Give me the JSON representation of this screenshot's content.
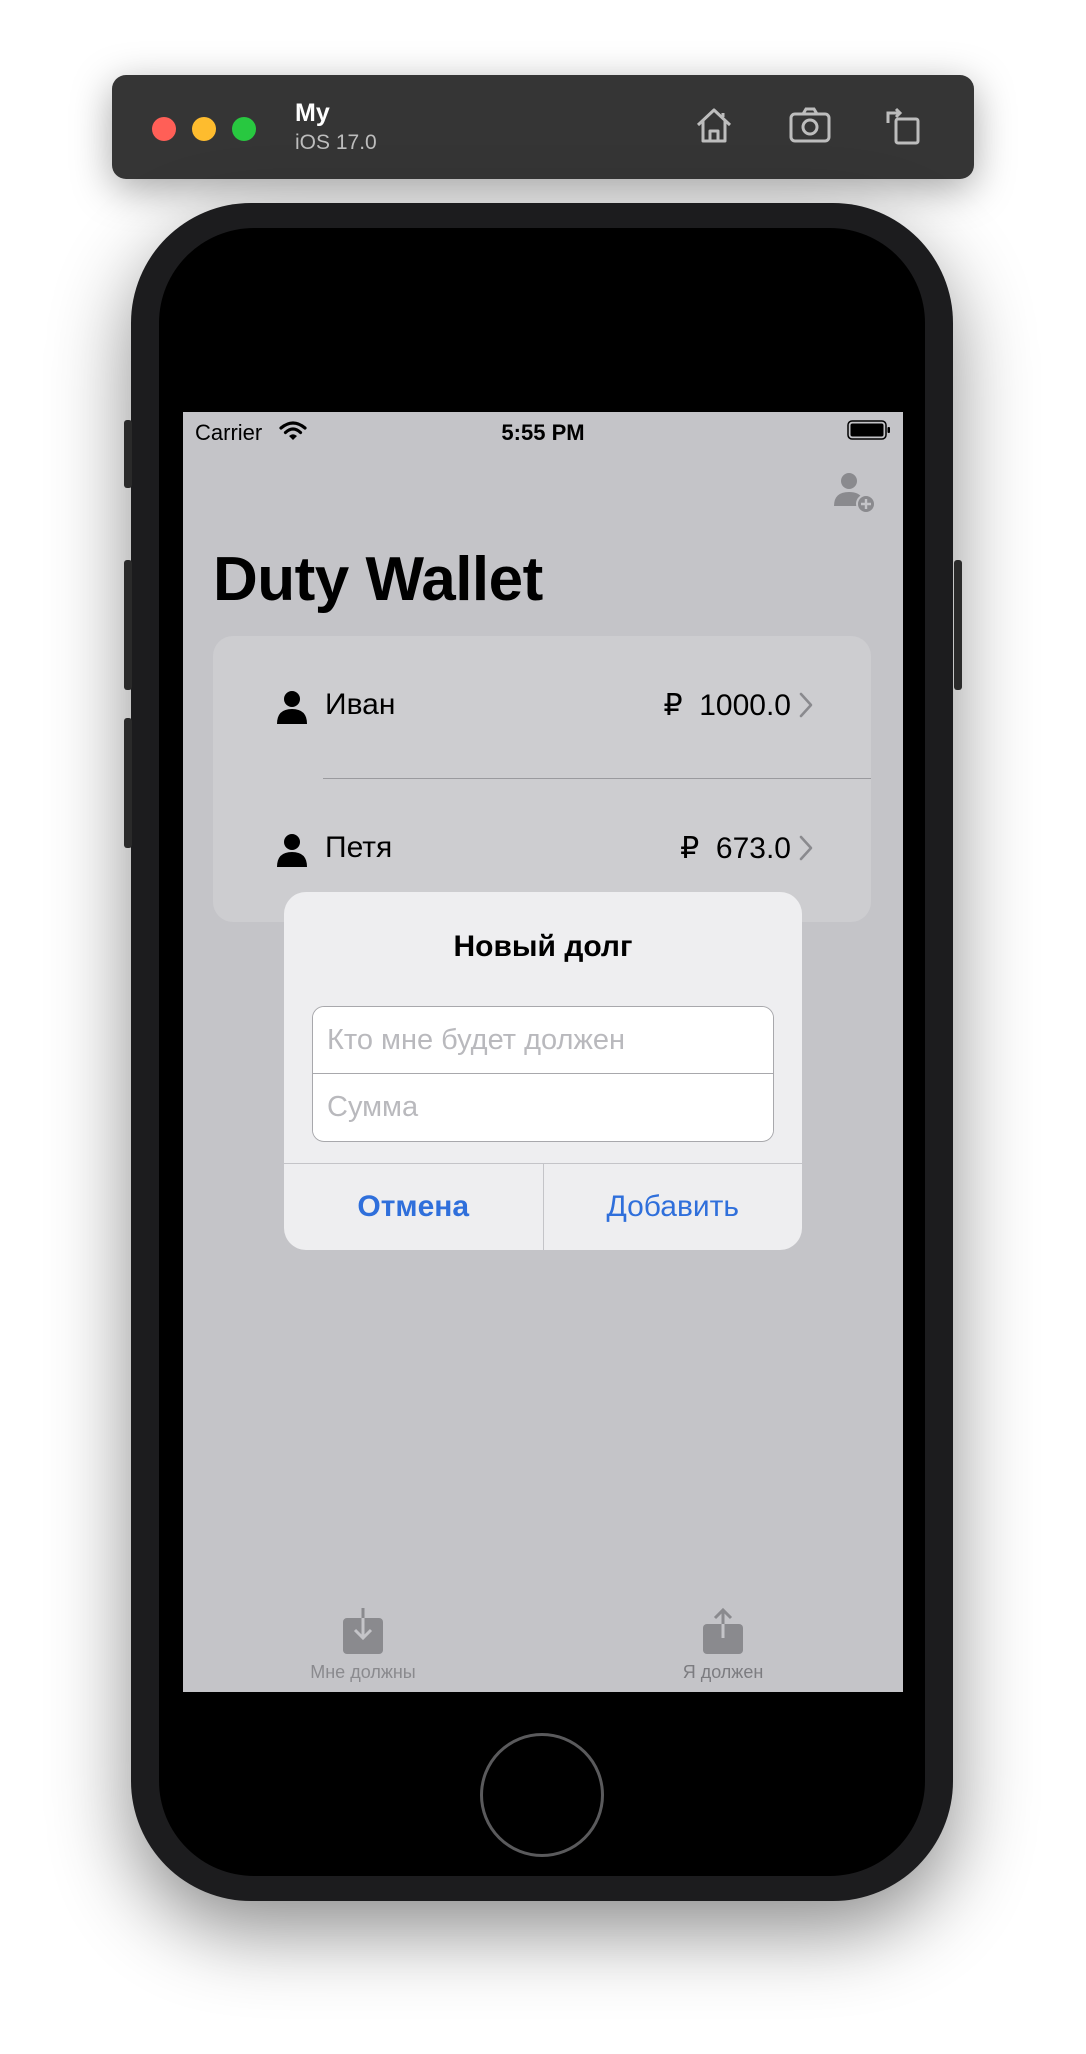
{
  "simulator": {
    "device_name": "My",
    "os_version": "iOS 17.0"
  },
  "status_bar": {
    "carrier": "Carrier",
    "time": "5:55 PM"
  },
  "app": {
    "title": "Duty Wallet"
  },
  "debts": [
    {
      "name": "Иван",
      "currency": "₽",
      "amount": "1000.0"
    },
    {
      "name": "Петя",
      "currency": "₽",
      "amount": "673.0"
    }
  ],
  "alert": {
    "title": "Новый долг",
    "name_placeholder": "Кто мне будет должен",
    "amount_placeholder": "Сумма",
    "cancel_label": "Отмена",
    "add_label": "Добавить"
  },
  "tab_bar": {
    "tabs": [
      {
        "label": "Мне должны",
        "icon": "tray-arrow-down-icon"
      },
      {
        "label": "Я должен",
        "icon": "square-arrow-up-icon"
      }
    ]
  },
  "colors": {
    "accent": "#2f6fdb",
    "screen_dim": "#c4c4c8",
    "alert_bg": "#eeeef0"
  }
}
